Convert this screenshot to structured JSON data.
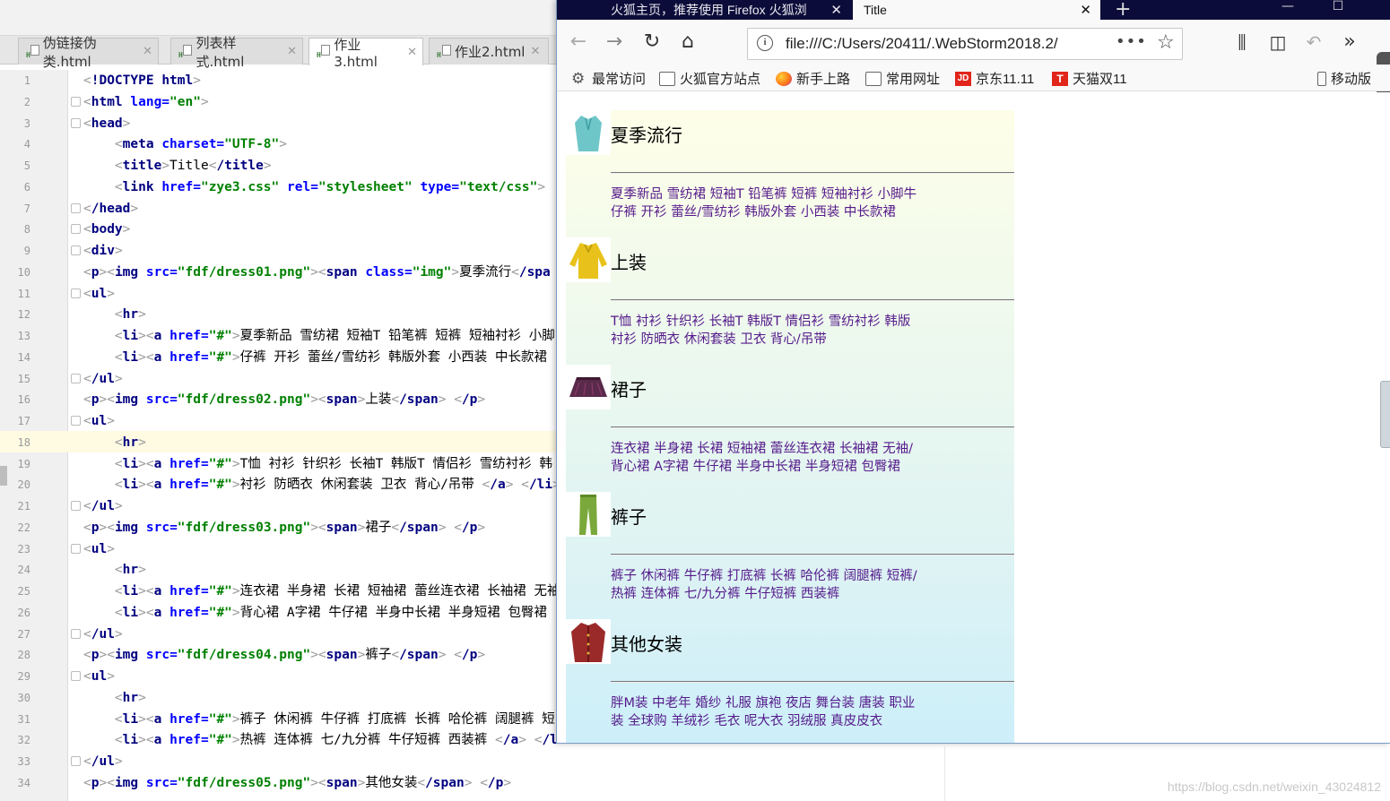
{
  "ide": {
    "tabs": [
      {
        "label": "伪链接伪类.html",
        "active": false
      },
      {
        "label": "列表样式.html",
        "active": false
      },
      {
        "label": "作业3.html",
        "active": true
      },
      {
        "label": "作业2.html",
        "active": false
      }
    ],
    "active_line": 18,
    "code_lines": [
      {
        "n": "1",
        "html": "<span class='p'>&lt;</span><span class='t'>!DOCTYPE</span> <span class='t'>html</span><span class='p'>&gt;</span>"
      },
      {
        "n": "2",
        "html": "<span class='p'>&lt;</span><span class='t'>html</span> <span class='a'>lang=</span><span class='v'>\"en\"</span><span class='p'>&gt;</span>"
      },
      {
        "n": "3",
        "html": "<span class='p'>&lt;</span><span class='t'>head</span><span class='p'>&gt;</span>"
      },
      {
        "n": "4",
        "html": "    <span class='p'>&lt;</span><span class='t'>meta</span> <span class='a'>charset=</span><span class='v'>\"UTF-8\"</span><span class='p'>&gt;</span>"
      },
      {
        "n": "5",
        "html": "    <span class='p'>&lt;</span><span class='t'>title</span><span class='p'>&gt;</span>Title<span class='p'>&lt;</span><span class='t'>/title</span><span class='p'>&gt;</span>"
      },
      {
        "n": "6",
        "html": "    <span class='p'>&lt;</span><span class='t'>link</span> <span class='a'>href=</span><span class='v'>\"zye3.css\"</span> <span class='a'>rel=</span><span class='v'>\"stylesheet\"</span> <span class='a'>type=</span><span class='v'>\"text/css\"</span><span class='p'>&gt;</span>"
      },
      {
        "n": "7",
        "html": "<span class='p'>&lt;</span><span class='t'>/head</span><span class='p'>&gt;</span>"
      },
      {
        "n": "8",
        "html": "<span class='p'>&lt;</span><span class='t'>body</span><span class='p'>&gt;</span>"
      },
      {
        "n": "9",
        "html": "<span class='p'>&lt;</span><span class='t'>div</span><span class='p'>&gt;</span>"
      },
      {
        "n": "10",
        "html": "<span class='p'>&lt;</span><span class='t'>p</span><span class='p'>&gt;&lt;</span><span class='t'>img</span> <span class='a'>src=</span><span class='v'>\"fdf/dress01.png\"</span><span class='p'>&gt;&lt;</span><span class='t'>span</span> <span class='a'>class=</span><span class='v'>\"img\"</span><span class='p'>&gt;</span>夏季流行<span class='p'>&lt;</span><span class='t'>/spa</span>"
      },
      {
        "n": "11",
        "html": "<span class='p'>&lt;</span><span class='t'>ul</span><span class='p'>&gt;</span>"
      },
      {
        "n": "12",
        "html": "    <span class='p'>&lt;</span><span class='t'>hr</span><span class='p'>&gt;</span>"
      },
      {
        "n": "13",
        "html": "    <span class='p'>&lt;</span><span class='t'>li</span><span class='p'>&gt;&lt;</span><span class='t'>a</span> <span class='a'>href=</span><span class='v'>\"#\"</span><span class='p'>&gt;</span>夏季新品 雪纺裙 短袖T 铅笔裤 短裤 短袖衬衫 小脚"
      },
      {
        "n": "14",
        "html": "    <span class='p'>&lt;</span><span class='t'>li</span><span class='p'>&gt;&lt;</span><span class='t'>a</span> <span class='a'>href=</span><span class='v'>\"#\"</span><span class='p'>&gt;</span>仔裤 开衫 蕾丝/雪纺衫 韩版外套 小西装 中长款裙"
      },
      {
        "n": "15",
        "html": "<span class='p'>&lt;</span><span class='t'>/ul</span><span class='p'>&gt;</span>"
      },
      {
        "n": "16",
        "html": "<span class='p'>&lt;</span><span class='t'>p</span><span class='p'>&gt;&lt;</span><span class='t'>img</span> <span class='a'>src=</span><span class='v'>\"fdf/dress02.png\"</span><span class='p'>&gt;&lt;</span><span class='t'>span</span><span class='p'>&gt;</span>上装<span class='p'>&lt;</span><span class='t'>/span</span><span class='p'>&gt;</span> <span class='p'>&lt;</span><span class='t'>/p</span><span class='p'>&gt;</span>"
      },
      {
        "n": "17",
        "html": "<span class='p'>&lt;</span><span class='t'>ul</span><span class='p'>&gt;</span>"
      },
      {
        "n": "18",
        "html": "    <span class='p'>&lt;</span><span class='t'>hr</span><span class='p'>&gt;</span>"
      },
      {
        "n": "19",
        "html": "    <span class='p'>&lt;</span><span class='t'>li</span><span class='p'>&gt;&lt;</span><span class='t'>a</span> <span class='a'>href=</span><span class='v'>\"#\"</span><span class='p'>&gt;</span>T恤 衬衫 针织衫 长袖T 韩版T 情侣衫 雪纺衬衫 韩"
      },
      {
        "n": "20",
        "html": "    <span class='p'>&lt;</span><span class='t'>li</span><span class='p'>&gt;&lt;</span><span class='t'>a</span> <span class='a'>href=</span><span class='v'>\"#\"</span><span class='p'>&gt;</span>衬衫 防晒衣 休闲套装 卫衣 背心/吊带 <span class='p'>&lt;</span><span class='t'>/a</span><span class='p'>&gt;</span> <span class='p'>&lt;</span><span class='t'>/li</span><span class='p'>&gt;</span>"
      },
      {
        "n": "21",
        "html": "<span class='p'>&lt;</span><span class='t'>/ul</span><span class='p'>&gt;</span>"
      },
      {
        "n": "22",
        "html": "<span class='p'>&lt;</span><span class='t'>p</span><span class='p'>&gt;&lt;</span><span class='t'>img</span> <span class='a'>src=</span><span class='v'>\"fdf/dress03.png\"</span><span class='p'>&gt;&lt;</span><span class='t'>span</span><span class='p'>&gt;</span>裙子<span class='p'>&lt;</span><span class='t'>/span</span><span class='p'>&gt;</span> <span class='p'>&lt;</span><span class='t'>/p</span><span class='p'>&gt;</span>"
      },
      {
        "n": "23",
        "html": "<span class='p'>&lt;</span><span class='t'>ul</span><span class='p'>&gt;</span>"
      },
      {
        "n": "24",
        "html": "    <span class='p'>&lt;</span><span class='t'>hr</span><span class='p'>&gt;</span>"
      },
      {
        "n": "25",
        "html": "    <span class='p'>&lt;</span><span class='t'>li</span><span class='p'>&gt;&lt;</span><span class='t'>a</span> <span class='a'>href=</span><span class='v'>\"#\"</span><span class='p'>&gt;</span>连衣裙 半身裙 长裙 短袖裙 蕾丝连衣裙 长袖裙 无袖"
      },
      {
        "n": "26",
        "html": "    <span class='p'>&lt;</span><span class='t'>li</span><span class='p'>&gt;&lt;</span><span class='t'>a</span> <span class='a'>href=</span><span class='v'>\"#\"</span><span class='p'>&gt;</span>背心裙 A字裙 牛仔裙 半身中长裙 半身短裙 包臀裙"
      },
      {
        "n": "27",
        "html": "<span class='p'>&lt;</span><span class='t'>/ul</span><span class='p'>&gt;</span>"
      },
      {
        "n": "28",
        "html": "<span class='p'>&lt;</span><span class='t'>p</span><span class='p'>&gt;&lt;</span><span class='t'>img</span> <span class='a'>src=</span><span class='v'>\"fdf/dress04.png\"</span><span class='p'>&gt;&lt;</span><span class='t'>span</span><span class='p'>&gt;</span>裤子<span class='p'>&lt;</span><span class='t'>/span</span><span class='p'>&gt;</span> <span class='p'>&lt;</span><span class='t'>/p</span><span class='p'>&gt;</span>"
      },
      {
        "n": "29",
        "html": "<span class='p'>&lt;</span><span class='t'>ul</span><span class='p'>&gt;</span>"
      },
      {
        "n": "30",
        "html": "    <span class='p'>&lt;</span><span class='t'>hr</span><span class='p'>&gt;</span>"
      },
      {
        "n": "31",
        "html": "    <span class='p'>&lt;</span><span class='t'>li</span><span class='p'>&gt;&lt;</span><span class='t'>a</span> <span class='a'>href=</span><span class='v'>\"#\"</span><span class='p'>&gt;</span>裤子 休闲裤 牛仔裤 打底裤 长裤 哈伦裤 阔腿裤 短"
      },
      {
        "n": "32",
        "html": "    <span class='p'>&lt;</span><span class='t'>li</span><span class='p'>&gt;&lt;</span><span class='t'>a</span> <span class='a'>href=</span><span class='v'>\"#\"</span><span class='p'>&gt;</span>热裤 连体裤 七/九分裤 牛仔短裤 西装裤 <span class='p'>&lt;</span><span class='t'>/a</span><span class='p'>&gt;</span> <span class='p'>&lt;</span><span class='t'>/l</span>"
      },
      {
        "n": "33",
        "html": "<span class='p'>&lt;</span><span class='t'>/ul</span><span class='p'>&gt;</span>"
      },
      {
        "n": "34",
        "html": "<span class='p'>&lt;</span><span class='t'>p</span><span class='p'>&gt;&lt;</span><span class='t'>img</span> <span class='a'>src=</span><span class='v'>\"fdf/dress05.png\"</span><span class='p'>&gt;&lt;</span><span class='t'>span</span><span class='p'>&gt;</span>其他女装<span class='p'>&lt;</span><span class='t'>/span</span><span class='p'>&gt;</span> <span class='p'>&lt;</span><span class='t'>/p</span><span class='p'>&gt;</span>"
      }
    ],
    "fold_lines": [
      2,
      3,
      7,
      8,
      9,
      11,
      15,
      17,
      21,
      23,
      27,
      29,
      33
    ]
  },
  "browser": {
    "tab1_title": "火狐主页，推荐使用 Firefox 火狐浏",
    "tab2_title": "Title",
    "url": "file:///C:/Users/20411/.WebStorm2018.2/",
    "bookmarks": [
      {
        "label": "最常访问",
        "icon": "gear-icon"
      },
      {
        "label": "火狐官方站点",
        "icon": "folder-icon"
      },
      {
        "label": "新手上路",
        "icon": "firefox-icon"
      },
      {
        "label": "常用网址",
        "icon": "folder-icon"
      },
      {
        "label": "京东11.11",
        "icon": "jd-icon"
      },
      {
        "label": "天猫双11",
        "icon": "tmall-icon"
      }
    ],
    "mobile_bookmarks": "移动版"
  },
  "page": {
    "categories": [
      {
        "title": "夏季流行",
        "line1": "夏季新品 雪纺裙 短袖T 铅笔裤 短裤 短袖衬衫 小脚牛",
        "line2": "仔裤 开衫 蕾丝/雪纺衫 韩版外套 小西装 中长款裙",
        "img": "dress01"
      },
      {
        "title": "上装",
        "line1": "T恤 衬衫 针织衫 长袖T 韩版T 情侣衫 雪纺衬衫 韩版",
        "line2": "衬衫 防晒衣 休闲套装 卫衣 背心/吊带",
        "img": "dress02"
      },
      {
        "title": "裙子",
        "line1": "连衣裙 半身裙 长裙 短袖裙 蕾丝连衣裙 长袖裙 无袖/",
        "line2": "背心裙 A字裙 牛仔裙 半身中长裙 半身短裙 包臀裙",
        "img": "dress03"
      },
      {
        "title": "裤子",
        "line1": "裤子 休闲裤 牛仔裤 打底裤 长裤 哈伦裤 阔腿裤 短裤/",
        "line2": "热裤 连体裤 七/九分裤 牛仔短裤 西装裤",
        "img": "dress04"
      },
      {
        "title": "其他女装",
        "line1": "胖M装 中老年 婚纱 礼服 旗袍 夜店 舞台装 唐装 职业",
        "line2": "装 全球购 羊绒衫 毛衣 呢大衣 羽绒服 真皮皮衣",
        "img": "dress05"
      }
    ]
  },
  "watermark": "https://blog.csdn.net/weixin_43024812",
  "colors": {
    "link": "#551a8b",
    "ff_tabstrip": "#0c0c3a",
    "tag": "#000080",
    "attr": "#0000ff",
    "value": "#008000"
  }
}
